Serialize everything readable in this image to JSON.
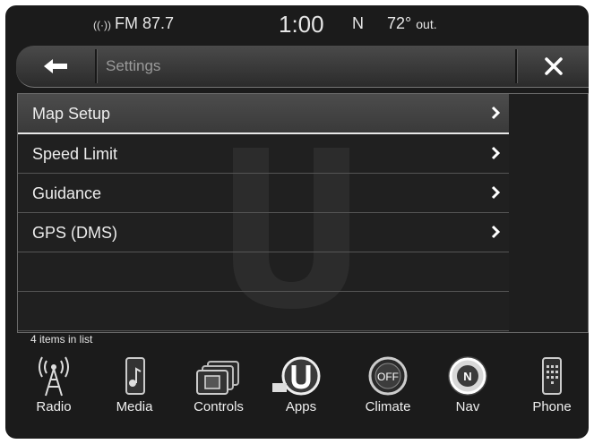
{
  "status_bar": {
    "radio": "FM 87.7",
    "clock": "1:00",
    "heading": "N",
    "temperature": "72°",
    "temperature_suffix": "out."
  },
  "title_bar": {
    "title": "Settings",
    "back_icon": "back-arrow-icon",
    "close_icon": "close-icon"
  },
  "menu": {
    "items": [
      {
        "label": "Map Setup",
        "selected": true
      },
      {
        "label": "Speed Limit",
        "selected": false
      },
      {
        "label": "Guidance",
        "selected": false
      },
      {
        "label": "GPS (DMS)",
        "selected": false
      }
    ],
    "count_text": "4 items in list"
  },
  "dock": {
    "items": [
      {
        "label": "Radio",
        "icon": "radio-tower-icon"
      },
      {
        "label": "Media",
        "icon": "media-icon"
      },
      {
        "label": "Controls",
        "icon": "controls-icon"
      },
      {
        "label": "Apps",
        "icon": "apps-icon"
      },
      {
        "label": "Climate",
        "icon": "climate-off-icon"
      },
      {
        "label": "Nav",
        "icon": "compass-icon",
        "active": true
      },
      {
        "label": "Phone",
        "icon": "phone-icon"
      }
    ],
    "climate_icon_text": "OFF",
    "nav_icon_text": "N"
  },
  "colors": {
    "background": "#1b1b1b",
    "text": "#ececec",
    "dim_text": "#9a9a9a"
  }
}
